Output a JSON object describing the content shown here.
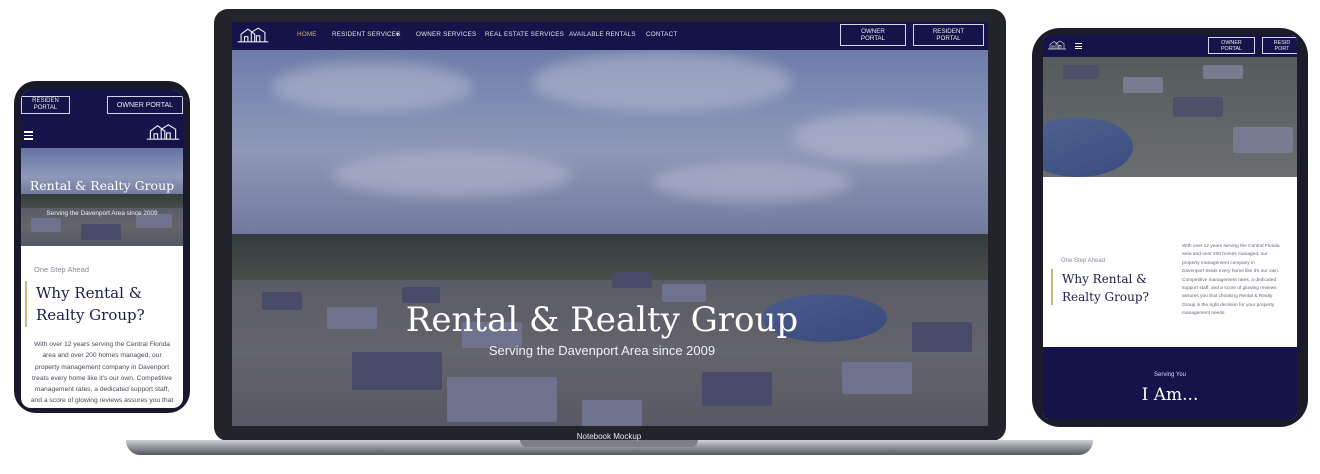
{
  "brand": {
    "title": "Rental & Realty Group",
    "tagline": "Serving the Davenport Area since 2009",
    "accent_navy": "#14144a",
    "gold": "#c9b877"
  },
  "nav": {
    "home": "HOME",
    "resident_services": "RESIDENT SERVICES",
    "owner_services": "OWNER SERVICES",
    "real_estate_services": "REAL ESTATE SERVICES",
    "available_rentals": "AVAILABLE RENTALS",
    "contact": "CONTACT",
    "dropdown_glyph": "▼"
  },
  "portals": {
    "owner_l1": "OWNER",
    "owner_l2": "PORTAL",
    "resident_l1": "RESIDENT",
    "resident_l2": "PORTAL",
    "owner_one_line": "OWNER PORTAL",
    "resident_cut_l1": "RESIDEN",
    "resident_cut_tablet_l1": "RESID",
    "resident_cut_tablet_l2": "PORT"
  },
  "mockup_label": "Notebook Mockup",
  "about": {
    "kicker": "One Step Ahead",
    "heading_l1": "Why Rental &",
    "heading_l2": "Realty Group?",
    "phone_body": [
      "With over 12 years serving the Central Florida",
      "area and over 200 homes managed, our",
      "property management company in Davenport",
      "treats every home like it's our own. Competitive",
      "management rates, a dedicated support staff,",
      "and a score of glowing reviews assures you that"
    ],
    "tablet_body": [
      "With over 12 years serving the Central Florida",
      "area and over 200 homes managed, our",
      "property management company in",
      "Davenport treats every home like it's our own.",
      "Competitive management rates, a dedicated",
      "support staff, and a score of glowing reviews",
      "assures you that choosing Rental & Realty",
      "Group is the right decision for your property",
      "management needs."
    ]
  },
  "serving": {
    "kicker": "Serving You",
    "heading": "I Am..."
  },
  "icons": {
    "menu": "hamburger-menu-icon",
    "logo": "house-logo-icon"
  }
}
